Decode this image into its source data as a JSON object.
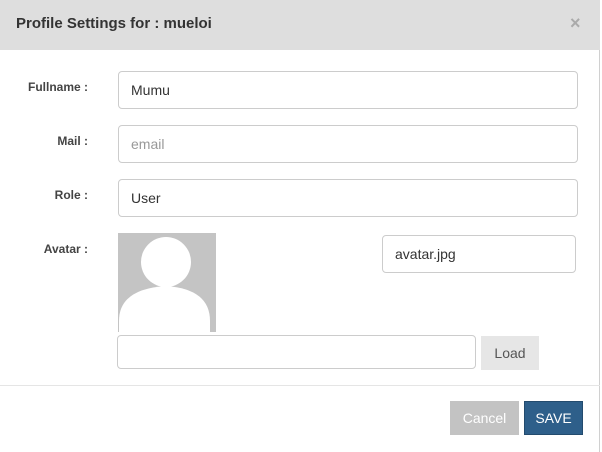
{
  "modal": {
    "title": "Profile Settings for : mueloi",
    "close_glyph": "×"
  },
  "form": {
    "fullname_label": "Fullname :",
    "fullname_value": "Mumu",
    "mail_label": "Mail :",
    "mail_value": "",
    "mail_placeholder": "email",
    "role_label": "Role :",
    "role_value": "User",
    "avatar_label": "Avatar :",
    "avatar_filename": "avatar.jpg",
    "avatar_path_value": "",
    "load_label": "Load"
  },
  "footer": {
    "cancel_label": "Cancel",
    "save_label": "SAVE"
  },
  "colors": {
    "header_bg": "#dedede",
    "save_bg": "#2e5f8a",
    "cancel_bg": "#c3c3c3"
  },
  "icons": {
    "close": "close-icon",
    "avatar": "user-silhouette-icon"
  }
}
